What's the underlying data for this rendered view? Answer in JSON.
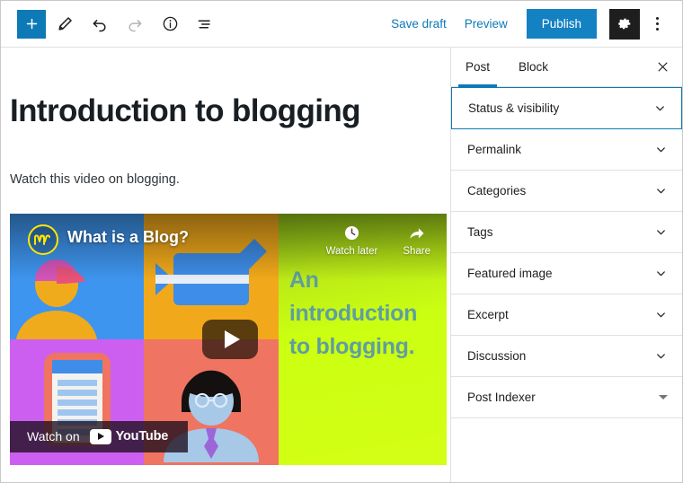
{
  "toolbar": {
    "add_block_icon": "plus-icon",
    "edit_icon": "pencil-icon",
    "undo_icon": "undo-arrow-icon",
    "redo_icon": "redo-arrow-icon",
    "info_icon": "info-circle-icon",
    "list_view_icon": "list-view-icon",
    "save_draft_label": "Save draft",
    "preview_label": "Preview",
    "publish_label": "Publish",
    "settings_icon": "gear-icon",
    "more_options_icon": "vertical-ellipsis-icon",
    "accent_color": "#0d7ab7",
    "publish_color": "#1481c3"
  },
  "editor": {
    "title": "Introduction to blogging",
    "paragraph": "Watch this video on blogging."
  },
  "video": {
    "channel_title": "What is a Blog?",
    "headline": "An introduction to blogging.",
    "watch_later_label": "Watch later",
    "watch_later_icon": "clock-icon",
    "share_label": "Share",
    "share_icon": "share-arrow-icon",
    "play_icon": "play-triangle-icon",
    "watch_on_label": "Watch on",
    "youtube_label": "YouTube",
    "youtube_icon": "youtube-play-icon",
    "logo_icon": "channel-logo-icon",
    "panel_colors": {
      "top_left": "#3e95ef",
      "top_right": "#f1a91b",
      "bottom_left": "#cd5ff0",
      "bottom_right": "#ef7461",
      "right": "#cbff12"
    },
    "headline_color": "#5f9ea0"
  },
  "sidebar": {
    "tabs": [
      {
        "label": "Post",
        "active": true
      },
      {
        "label": "Block",
        "active": false
      }
    ],
    "close_icon": "close-x-icon",
    "panels": [
      {
        "label": "Status & visibility",
        "icon": "chevron-down-icon",
        "focused": true
      },
      {
        "label": "Permalink",
        "icon": "chevron-down-icon",
        "focused": false
      },
      {
        "label": "Categories",
        "icon": "chevron-down-icon",
        "focused": false
      },
      {
        "label": "Tags",
        "icon": "chevron-down-icon",
        "focused": false
      },
      {
        "label": "Featured image",
        "icon": "chevron-down-icon",
        "focused": false
      },
      {
        "label": "Excerpt",
        "icon": "chevron-down-icon",
        "focused": false
      },
      {
        "label": "Discussion",
        "icon": "chevron-down-icon",
        "focused": false
      },
      {
        "label": "Post Indexer",
        "icon": "triangle-down-icon",
        "focused": false
      }
    ]
  }
}
